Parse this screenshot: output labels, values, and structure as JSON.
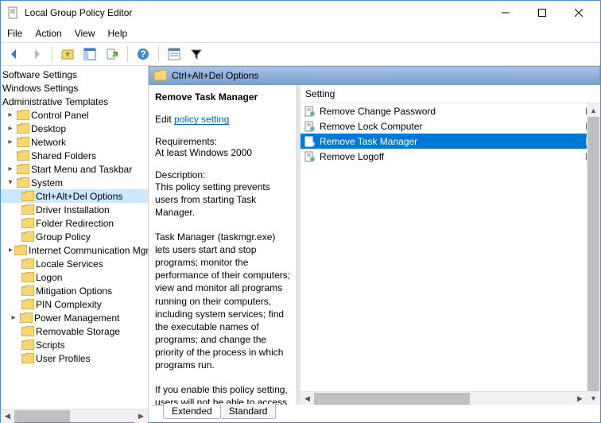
{
  "window": {
    "title": "Local Group Policy Editor"
  },
  "menu": {
    "file": "File",
    "action": "Action",
    "view": "View",
    "help": "Help"
  },
  "tree": {
    "top": [
      "Software Settings",
      "Windows Settings",
      "Administrative Templates"
    ],
    "items": [
      "Control Panel",
      "Desktop",
      "Network",
      "Shared Folders",
      "Start Menu and Taskbar",
      "System"
    ],
    "sub": [
      "Ctrl+Alt+Del Options",
      "Driver Installation",
      "Folder Redirection",
      "Group Policy",
      "Internet Communication Mgmt",
      "Locale Services",
      "Logon",
      "Mitigation Options",
      "PIN Complexity",
      "Power Management",
      "Removable Storage",
      "Scripts",
      "User Profiles"
    ]
  },
  "header": {
    "title": "Ctrl+Alt+Del Options"
  },
  "detail": {
    "setting_name": "Remove Task Manager",
    "edit_prefix": "Edit ",
    "edit_link": "policy setting",
    "req_label": "Requirements:",
    "req_val": "At least Windows 2000",
    "desc_label": "Description:",
    "p1": "This policy setting prevents users from starting Task Manager.",
    "p2": "Task Manager (taskmgr.exe) lets users start and stop programs; monitor the performance of their computers; view and monitor all programs running on their computers, including system services; find the executable names of programs; and change the priority of the process in which programs run.",
    "p3": "If you enable this policy setting, users will not be able to access"
  },
  "list": {
    "col_setting": "Setting",
    "rows": [
      {
        "label": "Remove Change Password",
        "state": "Not"
      },
      {
        "label": "Remove Lock Computer",
        "state": "Not"
      },
      {
        "label": "Remove Task Manager",
        "state": "Not",
        "selected": true
      },
      {
        "label": "Remove Logoff",
        "state": "Not"
      }
    ]
  },
  "tabs": {
    "extended": "Extended",
    "standard": "Standard"
  }
}
